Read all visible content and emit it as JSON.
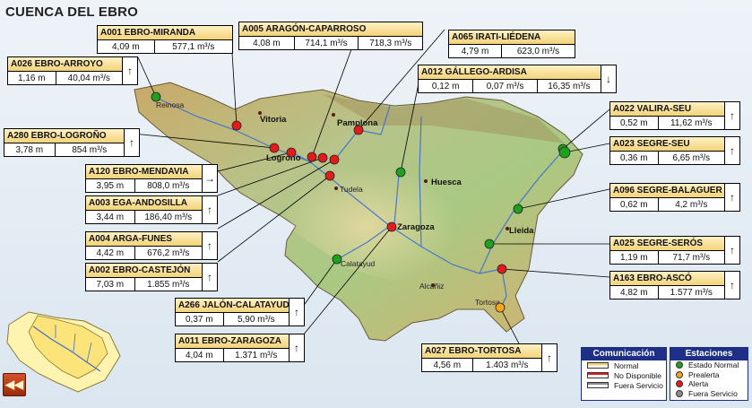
{
  "title": "CUENCA DEL EBRO",
  "colors": {
    "alert": "#e41b1b",
    "normal": "#1fa01f",
    "prealert": "#f3a51c",
    "out_of_service": "#8c8c8c",
    "header_fill": "#f3d37a",
    "legend_header": "#1d2f86"
  },
  "cities": [
    {
      "name": "Reinosa",
      "style": "small"
    },
    {
      "name": "Vitoria",
      "style": "bold"
    },
    {
      "name": "Pamplona",
      "style": "bold"
    },
    {
      "name": "Logroño",
      "style": "bold"
    },
    {
      "name": "Tudela",
      "style": "small"
    },
    {
      "name": "Huesca",
      "style": "bold"
    },
    {
      "name": "Zaragoza",
      "style": "bold"
    },
    {
      "name": "Lleida",
      "style": "bold"
    },
    {
      "name": "Calatayud",
      "style": "small"
    },
    {
      "name": "Alcañiz",
      "style": "small"
    },
    {
      "name": "Tortosa",
      "style": "small"
    }
  ],
  "stations": [
    {
      "code": "A001",
      "name": "EBRO-MIRANDA",
      "level": "4,09 m",
      "flow": "577,1 m³/s",
      "flow2": "",
      "trend": "",
      "status": "alert"
    },
    {
      "code": "A005",
      "name": "ARAGÓN-CAPARROSO",
      "level": "4,08 m",
      "flow": "714,1 m³/s",
      "flow2": "718,3 m³/s",
      "trend": "",
      "status": "alert"
    },
    {
      "code": "A065",
      "name": "IRATI-LIÉDENA",
      "level": "4,79 m",
      "flow": "623,0 m³/s",
      "flow2": "",
      "trend": "",
      "status": "alert"
    },
    {
      "code": "A026",
      "name": "EBRO-ARROYO",
      "level": "1,16 m",
      "flow": "40,04 m³/s",
      "flow2": "",
      "trend": "↑",
      "status": "normal"
    },
    {
      "code": "A012",
      "name": "GÁLLEGO-ARDISA",
      "level": "0,12 m",
      "flow": "0,07 m³/s",
      "flow2": "16,35 m³/s",
      "trend": "↓",
      "status": "normal"
    },
    {
      "code": "A280",
      "name": "EBRO-LOGROÑO",
      "level": "3,78 m",
      "flow": "854 m³/s",
      "flow2": "",
      "trend": "↑",
      "status": "alert"
    },
    {
      "code": "A022",
      "name": "VALIRA-SEU",
      "level": "0,52 m",
      "flow": "11,62 m³/s",
      "flow2": "",
      "trend": "↑",
      "status": "normal"
    },
    {
      "code": "A023",
      "name": "SEGRE-SEU",
      "level": "0,36 m",
      "flow": "6,65 m³/s",
      "flow2": "",
      "trend": "↑",
      "status": "normal"
    },
    {
      "code": "A120",
      "name": "EBRO-MENDAVIA",
      "level": "3,95 m",
      "flow": "808,0 m³/s",
      "flow2": "",
      "trend": "→",
      "status": "alert"
    },
    {
      "code": "A003",
      "name": "EGA-ANDOSILLA",
      "level": "3,44 m",
      "flow": "186,40 m³/s",
      "flow2": "",
      "trend": "↑",
      "status": "alert"
    },
    {
      "code": "A096",
      "name": "SEGRE-BALAGUER",
      "level": "0,62 m",
      "flow": "4,2 m³/s",
      "flow2": "",
      "trend": "↑",
      "status": "normal"
    },
    {
      "code": "A004",
      "name": "ARGA-FUNES",
      "level": "4,42 m",
      "flow": "676,2 m³/s",
      "flow2": "",
      "trend": "↑",
      "status": "alert"
    },
    {
      "code": "A025",
      "name": "SEGRE-SERÓS",
      "level": "1,19 m",
      "flow": "71,7 m³/s",
      "flow2": "",
      "trend": "↑",
      "status": "normal"
    },
    {
      "code": "A002",
      "name": "EBRO-CASTEJÓN",
      "level": "7,03 m",
      "flow": "1.855 m³/s",
      "flow2": "",
      "trend": "↑",
      "status": "alert"
    },
    {
      "code": "A163",
      "name": "EBRO-ASCÓ",
      "level": "4,82 m",
      "flow": "1.577 m³/s",
      "flow2": "",
      "trend": "↑",
      "status": "alert"
    },
    {
      "code": "A266",
      "name": "JALÓN-CALATAYUD",
      "level": "0,37 m",
      "flow": "5,90 m³/s",
      "flow2": "",
      "trend": "↑",
      "status": "normal"
    },
    {
      "code": "A011",
      "name": "EBRO-ZARAGOZA",
      "level": "4,04 m",
      "flow": "1.371 m³/s",
      "flow2": "",
      "trend": "↑",
      "status": "alert"
    },
    {
      "code": "A027",
      "name": "EBRO-TORTOSA",
      "level": "4,56 m",
      "flow": "1.403 m³/s",
      "flow2": "",
      "trend": "↑",
      "status": "prealert"
    }
  ],
  "legend_comunicacion": {
    "title": "Comunicación",
    "items": [
      {
        "label": "Normal",
        "fill": "#ffffff",
        "band": "#f3d37a"
      },
      {
        "label": "No Disponible",
        "fill": "#ffffff",
        "band": "#e41b1b"
      },
      {
        "label": "Fuera Servicio",
        "fill": "#ffffff",
        "band": "#8c8c8c"
      }
    ]
  },
  "legend_estaciones": {
    "title": "Estaciones",
    "items": [
      {
        "label": "Estado Normal",
        "color": "#1fa01f"
      },
      {
        "label": "Prealerta",
        "color": "#f3a51c"
      },
      {
        "label": "Alerta",
        "color": "#e41b1b"
      },
      {
        "label": "Fuera Servicio",
        "color": "#8c8c8c"
      }
    ]
  },
  "back_button_label": "◀◀"
}
